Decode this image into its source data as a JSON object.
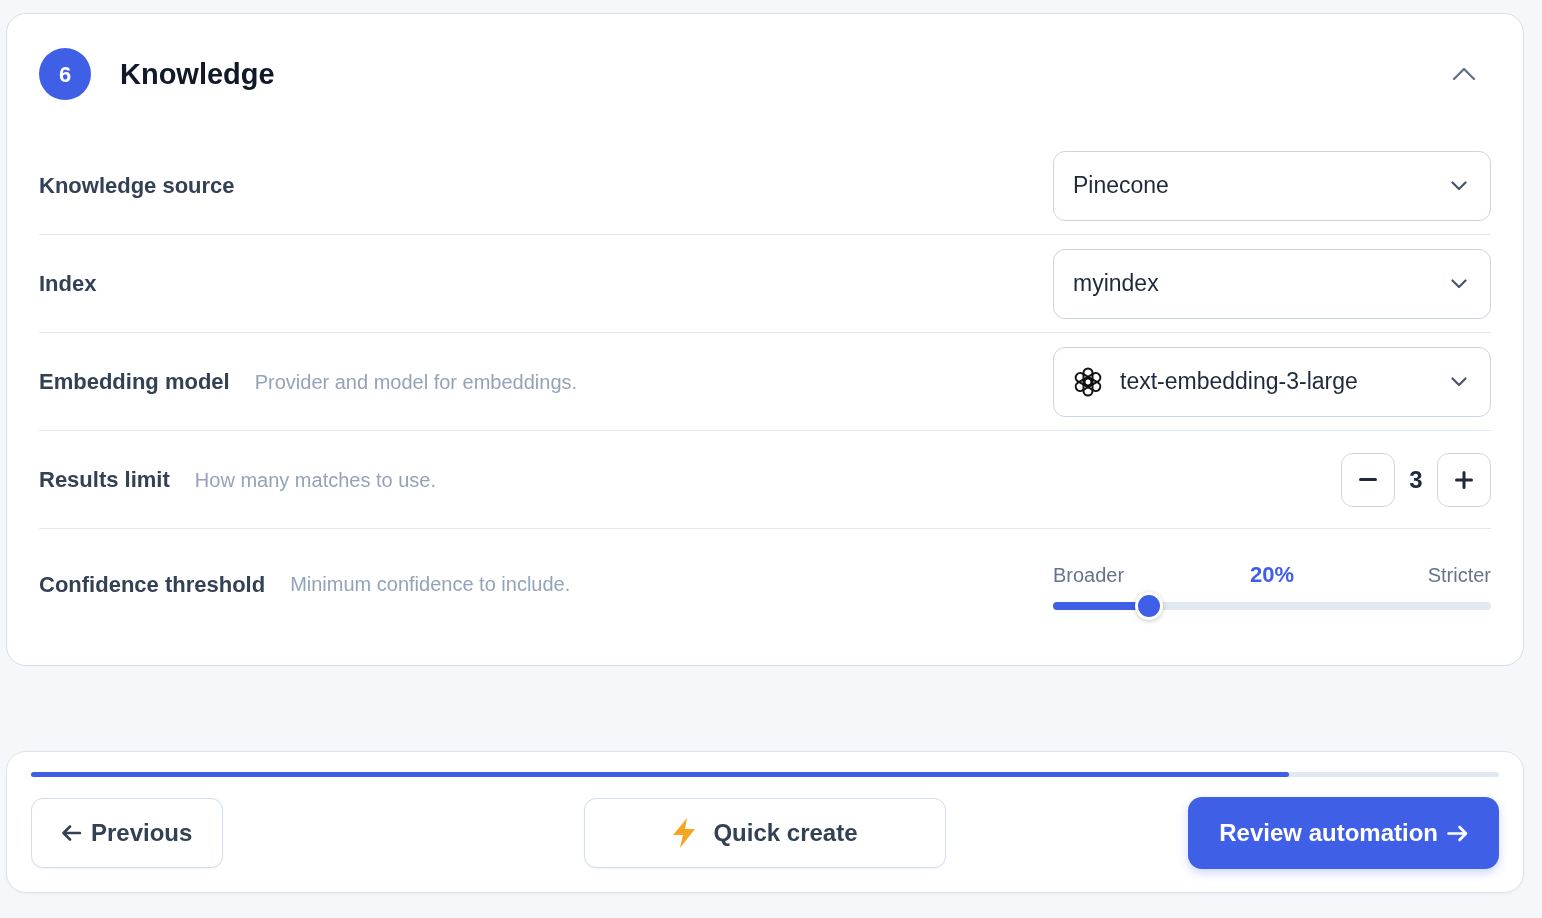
{
  "section": {
    "number": "6",
    "title": "Knowledge",
    "expanded": true
  },
  "fields": [
    {
      "kind": "select",
      "label": "Knowledge source",
      "value": "Pinecone"
    },
    {
      "kind": "select",
      "label": "Index",
      "value": "myindex"
    },
    {
      "kind": "model",
      "label": "Embedding model",
      "description": "Provider and model for embeddings.",
      "value": "text-embedding-3-large"
    },
    {
      "kind": "stepper",
      "label": "Results limit",
      "description": "How many matches to use.",
      "value": "3"
    },
    {
      "kind": "slider",
      "label": "Confidence threshold",
      "description": "Minimum confidence to include.",
      "min_label": "Broader",
      "reading": "20%",
      "max_label": "Stricter",
      "level": 0.2
    }
  ],
  "footer": {
    "progress": {
      "level": 0.857
    },
    "buttons": [
      {
        "kind": "back",
        "label": "Previous"
      },
      {
        "kind": "quick",
        "label": "Quick create"
      },
      {
        "kind": "primary",
        "label": "Review automation"
      }
    ]
  }
}
